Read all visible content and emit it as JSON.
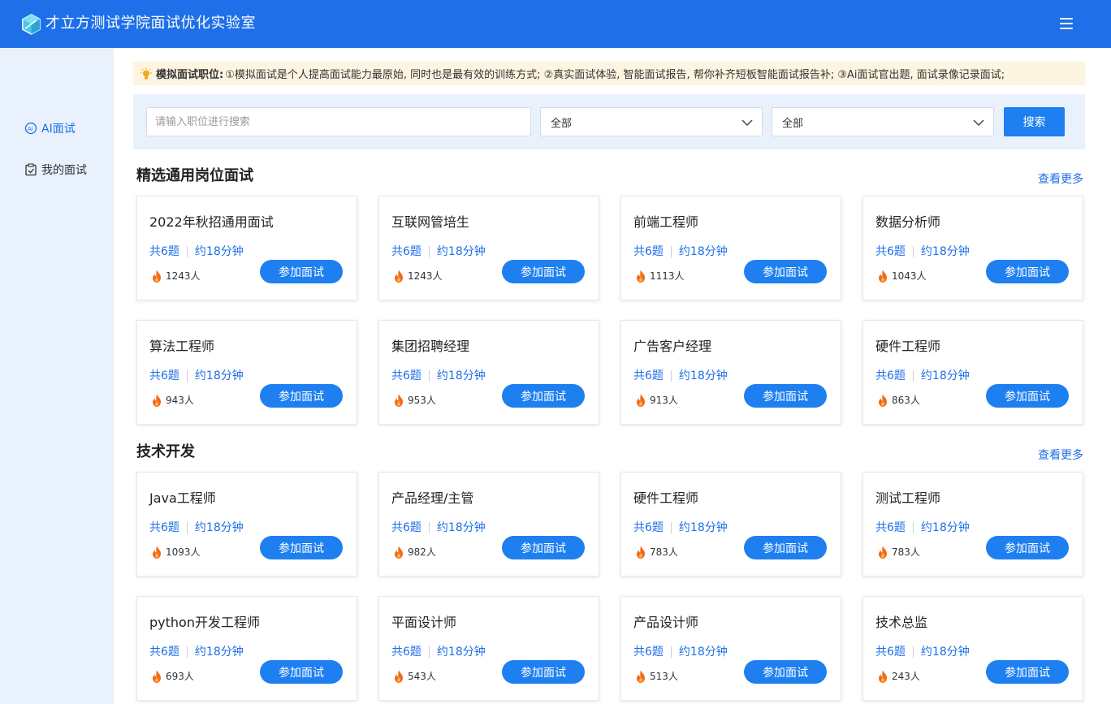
{
  "header": {
    "title": "才立方测试学院面试优化实验室",
    "logo_icon": "cube-logo-icon",
    "menu_icon": "hamburger-menu-icon"
  },
  "sidebar": {
    "items": [
      {
        "label": "AI面试",
        "icon": "ai-interview-icon",
        "active": true
      },
      {
        "label": "我的面试",
        "icon": "clipboard-check-icon",
        "active": false
      }
    ]
  },
  "notice": {
    "label": "模拟面试职位:",
    "text": "①模拟面试是个人提高面试能力最原始, 同时也是最有效的训练方式; ②真实面试体验, 智能面试报告, 帮你补齐短板智能面试报告补; ③Ai面试官出题, 面试录像记录面试;"
  },
  "search": {
    "placeholder": "请输入职位进行搜索",
    "value": "",
    "select1": "全部",
    "select2": "全部",
    "button": "搜索"
  },
  "colors": {
    "primary": "#1e6fe8",
    "button": "#1e7ff0",
    "sidebar_bg": "#e9f1fd",
    "notice_bg": "#fdf4e1",
    "fire": "#f26b1d"
  },
  "sections": [
    {
      "title": "精选通用岗位面试",
      "more": "查看更多",
      "cards": [
        {
          "title": "2022年秋招通用面试",
          "questions": "共6题",
          "duration": "约18分钟",
          "count": "1243人",
          "button": "参加面试"
        },
        {
          "title": "互联网管培生",
          "questions": "共6题",
          "duration": "约18分钟",
          "count": "1243人",
          "button": "参加面试"
        },
        {
          "title": "前端工程师",
          "questions": "共6题",
          "duration": "约18分钟",
          "count": "1113人",
          "button": "参加面试"
        },
        {
          "title": "数据分析师",
          "questions": "共6题",
          "duration": "约18分钟",
          "count": "1043人",
          "button": "参加面试"
        },
        {
          "title": "算法工程师",
          "questions": "共6题",
          "duration": "约18分钟",
          "count": "943人",
          "button": "参加面试"
        },
        {
          "title": "集团招聘经理",
          "questions": "共6题",
          "duration": "约18分钟",
          "count": "953人",
          "button": "参加面试"
        },
        {
          "title": "广告客户经理",
          "questions": "共6题",
          "duration": "约18分钟",
          "count": "913人",
          "button": "参加面试"
        },
        {
          "title": "硬件工程师",
          "questions": "共6题",
          "duration": "约18分钟",
          "count": "863人",
          "button": "参加面试"
        }
      ]
    },
    {
      "title": "技术开发",
      "more": "查看更多",
      "cards": [
        {
          "title": "Java工程师",
          "questions": "共6题",
          "duration": "约18分钟",
          "count": "1093人",
          "button": "参加面试"
        },
        {
          "title": "产品经理/主管",
          "questions": "共6题",
          "duration": "约18分钟",
          "count": "982人",
          "button": "参加面试"
        },
        {
          "title": "硬件工程师",
          "questions": "共6题",
          "duration": "约18分钟",
          "count": "783人",
          "button": "参加面试"
        },
        {
          "title": "测试工程师",
          "questions": "共6题",
          "duration": "约18分钟",
          "count": "783人",
          "button": "参加面试"
        },
        {
          "title": "python开发工程师",
          "questions": "共6题",
          "duration": "约18分钟",
          "count": "693人",
          "button": "参加面试"
        },
        {
          "title": "平面设计师",
          "questions": "共6题",
          "duration": "约18分钟",
          "count": "543人",
          "button": "参加面试"
        },
        {
          "title": "产品设计师",
          "questions": "共6题",
          "duration": "约18分钟",
          "count": "513人",
          "button": "参加面试"
        },
        {
          "title": "技术总监",
          "questions": "共6题",
          "duration": "约18分钟",
          "count": "243人",
          "button": "参加面试"
        }
      ]
    }
  ]
}
